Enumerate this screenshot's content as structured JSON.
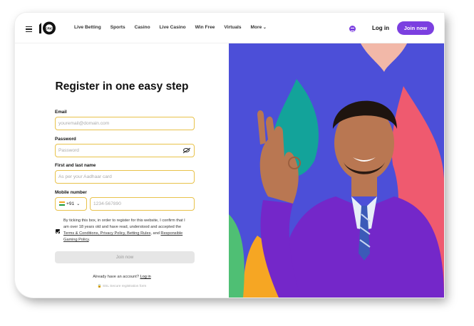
{
  "header": {
    "nav": [
      "Live Betting",
      "Sports",
      "Casino",
      "Live Casino",
      "Win Free",
      "Virtuals",
      "More"
    ],
    "login_label": "Log in",
    "join_label": "Join now"
  },
  "form": {
    "title": "Register in one easy step",
    "email": {
      "label": "Email",
      "placeholder": "youremail@domain.com"
    },
    "password": {
      "label": "Password",
      "placeholder": "Password"
    },
    "name": {
      "label": "First and last name",
      "placeholder": "As per your Aadhaar card"
    },
    "mobile": {
      "label": "Mobile number",
      "country_code": "+91",
      "placeholder": "1234-567890"
    },
    "consent": {
      "checked": true,
      "text_1": "By ticking this box, in order to register for this website, I confirm that I am over 18 years old and have read, understood and accepted the",
      "link_1": "Terms & Conditions, Privacy Policy, Betting Rules",
      "text_2": ", and",
      "link_2": "Responsible Gaming Policy",
      "text_3": "."
    },
    "join_label": "Join now",
    "already_text": "Already have an account?",
    "login_link": "Log in",
    "secure_text": "SSL Secure registration form"
  },
  "colors": {
    "brand_purple": "#7b3fe0",
    "hero_blue": "#4c4fd8",
    "input_border": "#e8c24a"
  },
  "icons": [
    "menu-icon",
    "10cric-logo",
    "chat-icon",
    "eye-off-icon",
    "india-flag-icon",
    "chevron-down-icon",
    "checkbox-checked-icon",
    "lock-icon"
  ]
}
